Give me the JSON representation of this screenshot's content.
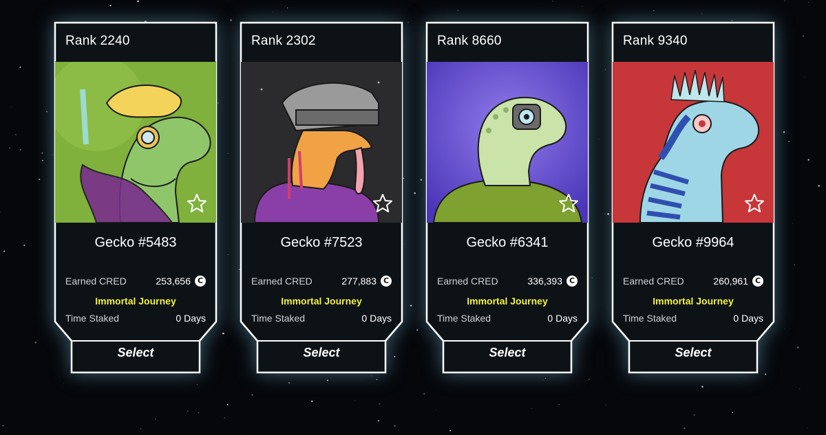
{
  "cards": [
    {
      "rank": "Rank 2240",
      "name": "Gecko #5483",
      "earned_label": "Earned CRED",
      "earned_value": "253,656",
      "journey": "Immortal Journey",
      "time_label": "Time Staked",
      "time_value": "0 Days",
      "select_label": "Select",
      "bg_color": "#7fb13c",
      "skin_color": "#8fc66a",
      "accent_color": "#7a2f8c"
    },
    {
      "rank": "Rank 2302",
      "name": "Gecko #7523",
      "earned_label": "Earned CRED",
      "earned_value": "277,883",
      "journey": "Immortal Journey",
      "time_label": "Time Staked",
      "time_value": "0 Days",
      "select_label": "Select",
      "bg_color": "#2b2b2d",
      "skin_color": "#f0a245",
      "accent_color": "#8a3fa8"
    },
    {
      "rank": "Rank 8660",
      "name": "Gecko #6341",
      "earned_label": "Earned CRED",
      "earned_value": "336,393",
      "journey": "Immortal Journey",
      "time_label": "Time Staked",
      "time_value": "0 Days",
      "select_label": "Select",
      "bg_color": "#6a4fd0",
      "skin_color": "#c9e3a8",
      "accent_color": "#7ea12f"
    },
    {
      "rank": "Rank 9340",
      "name": "Gecko #9964",
      "earned_label": "Earned CRED",
      "earned_value": "260,961",
      "journey": "Immortal Journey",
      "time_label": "Time Staked",
      "time_value": "0 Days",
      "select_label": "Select",
      "bg_color": "#c7373a",
      "skin_color": "#9fd6e6",
      "accent_color": "#2f4fb0"
    }
  ],
  "cred_symbol": "C",
  "colors": {
    "frame": "#ffffff",
    "card_bg": "#0d1217",
    "glow": "#4f7f95",
    "journey": "#f3f33c"
  }
}
